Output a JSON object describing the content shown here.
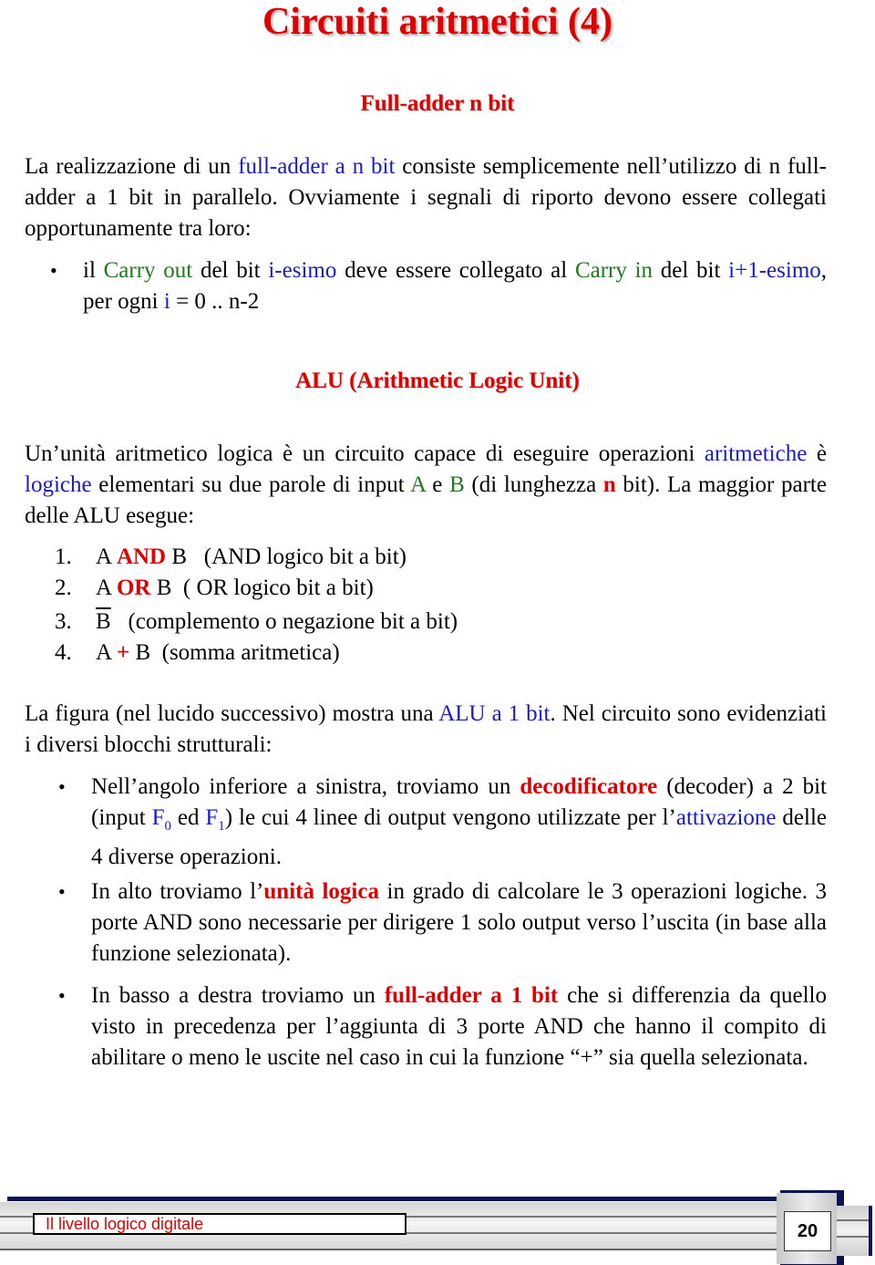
{
  "title": "Circuiti aritmetici (4)",
  "section1": {
    "heading": "Full-adder n bit",
    "para": [
      {
        "t": "La realizzazione di un ",
        "c": ""
      },
      {
        "t": "full-adder a n bit",
        "c": "blue"
      },
      {
        "t": " consiste semplicemente nell’utilizzo di n full-adder a 1 bit in parallelo. Ovviamente i segnali di riporto devono essere collegati opportunamente tra loro:",
        "c": ""
      }
    ],
    "bullet": [
      {
        "t": "il ",
        "c": ""
      },
      {
        "t": "Carry out",
        "c": "green"
      },
      {
        "t": " del bit ",
        "c": ""
      },
      {
        "t": "i-esimo",
        "c": "blue"
      },
      {
        "t": " deve essere collegato al ",
        "c": ""
      },
      {
        "t": "Carry in",
        "c": "green"
      },
      {
        "t": " del bit ",
        "c": ""
      },
      {
        "t": "i+1-esimo",
        "c": "blue"
      },
      {
        "t": ", per ogni ",
        "c": ""
      },
      {
        "t": "i",
        "c": "blue"
      },
      {
        "t": " = 0 .. n-2",
        "c": ""
      }
    ]
  },
  "section2": {
    "heading": "ALU (Arithmetic Logic Unit)",
    "para": [
      {
        "t": "Un’unità aritmetico logica è un circuito capace di eseguire operazioni ",
        "c": ""
      },
      {
        "t": "aritmetiche",
        "c": "blue"
      },
      {
        "t": " è ",
        "c": ""
      },
      {
        "t": "logiche",
        "c": "blue"
      },
      {
        "t": " elementari su due parole di input ",
        "c": ""
      },
      {
        "t": "A",
        "c": "green"
      },
      {
        "t": " e ",
        "c": ""
      },
      {
        "t": "B",
        "c": "green"
      },
      {
        "t": " (di lunghezza ",
        "c": ""
      },
      {
        "t": "n",
        "c": "redb"
      },
      {
        "t": " bit). La maggior parte delle ALU esegue:",
        "c": ""
      }
    ],
    "operations": [
      {
        "num": "1.",
        "parts": [
          {
            "t": "A ",
            "c": ""
          },
          {
            "t": "AND",
            "c": "redb"
          },
          {
            "t": " B   (AND logico bit a bit)",
            "c": ""
          }
        ]
      },
      {
        "num": "2.",
        "parts": [
          {
            "t": "A ",
            "c": ""
          },
          {
            "t": "OR",
            "c": "redb"
          },
          {
            "t": " B  ( OR logico bit a bit)",
            "c": ""
          }
        ]
      },
      {
        "num": "3.",
        "parts": [
          {
            "t": "B",
            "c": "overline"
          },
          {
            "t": "   (complemento o negazione bit a bit)",
            "c": ""
          }
        ]
      },
      {
        "num": "4.",
        "parts": [
          {
            "t": "A ",
            "c": ""
          },
          {
            "t": "+",
            "c": "redb"
          },
          {
            "t": " B  (somma aritmetica)",
            "c": ""
          }
        ]
      }
    ],
    "para2": [
      {
        "t": "La figura (nel lucido successivo) mostra una ",
        "c": ""
      },
      {
        "t": "ALU a 1 bit",
        "c": "blue"
      },
      {
        "t": ". Nel circuito sono evidenziati i diversi blocchi strutturali:",
        "c": ""
      }
    ],
    "bullets": [
      [
        {
          "t": "Nell’angolo inferiore a sinistra, troviamo un ",
          "c": ""
        },
        {
          "t": "decodificatore",
          "c": "redb"
        },
        {
          "t": " (decoder) a 2 bit (input ",
          "c": ""
        },
        {
          "t": "F",
          "c": "blue"
        },
        {
          "t": "0",
          "c": "blue-sub"
        },
        {
          "t": " ed ",
          "c": ""
        },
        {
          "t": "F",
          "c": "blue"
        },
        {
          "t": "1",
          "c": "blue-sub"
        },
        {
          "t": ") le cui 4 linee di output vengono utilizzate per l’",
          "c": ""
        },
        {
          "t": "attivazione",
          "c": "blue"
        },
        {
          "t": " delle 4 diverse operazioni.",
          "c": ""
        }
      ],
      [
        {
          "t": "In alto troviamo l’",
          "c": ""
        },
        {
          "t": "unità logica",
          "c": "redb"
        },
        {
          "t": " in grado di calcolare le 3 operazioni logiche. 3 porte AND sono necessarie per dirigere 1 solo output verso l’uscita (in base alla funzione selezionata).",
          "c": ""
        }
      ],
      [
        {
          "t": "In basso a destra troviamo un ",
          "c": ""
        },
        {
          "t": "full-adder a 1 bit",
          "c": "redb"
        },
        {
          "t": " che si differenzia da quello visto in precedenza per l’aggiunta di 3 porte AND che hanno il compito di abilitare o meno le uscite nel caso in cui la funzione “+” sia quella selezionata.",
          "c": ""
        }
      ]
    ]
  },
  "footer": {
    "label": "Il livello logico digitale",
    "page": "20"
  },
  "colors": {
    "title_red": "#e00000",
    "link_blue": "#1a1ac8",
    "term_green": "#1e7a1e",
    "footer_navy": "#0b1450"
  }
}
